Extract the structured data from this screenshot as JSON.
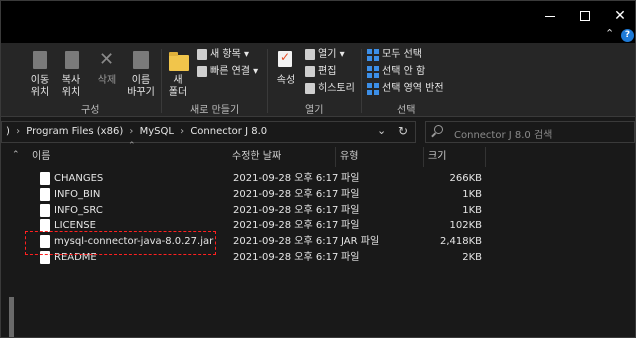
{
  "window_controls": {
    "minimize": "minimize",
    "maximize": "maximize",
    "close": "close"
  },
  "ribbon": {
    "buttons": {
      "move_to": "이동\n위치",
      "copy_to": "복사\n위치",
      "delete": "삭제",
      "rename": "이름\n바꾸기",
      "new_folder": "새\n폴더",
      "new_item": "새 항목",
      "easy_access": "빠른 연결",
      "properties": "속성",
      "open": "열기",
      "edit": "편집",
      "history": "히스토리",
      "select_all": "모두 선택",
      "select_none": "선택 안 함",
      "invert_selection": "선택 영역 반전"
    },
    "groups": {
      "organize": "구성",
      "new": "새로 만들기",
      "open": "열기",
      "select": "선택"
    }
  },
  "address": {
    "crumbs": [
      "Program Files (x86)",
      "MySQL",
      "Connector J 8.0"
    ],
    "leading_sep": ")"
  },
  "search": {
    "placeholder": "Connector J 8.0 검색"
  },
  "columns": {
    "name": "이름",
    "date": "수정한 날짜",
    "type": "유형",
    "size": "크기"
  },
  "files": [
    {
      "name": "CHANGES",
      "date": "2021-09-28 오후 6:17",
      "type": "파일",
      "size": "266KB"
    },
    {
      "name": "INFO_BIN",
      "date": "2021-09-28 오후 6:17",
      "type": "파일",
      "size": "1KB"
    },
    {
      "name": "INFO_SRC",
      "date": "2021-09-28 오후 6:17",
      "type": "파일",
      "size": "1KB"
    },
    {
      "name": "LICENSE",
      "date": "2021-09-28 오후 6:17",
      "type": "파일",
      "size": "102KB"
    },
    {
      "name": "mysql-connector-java-8.0.27.jar",
      "date": "2021-09-28 오후 6:17",
      "type": "JAR 파일",
      "size": "2,418KB"
    },
    {
      "name": "README",
      "date": "2021-09-28 오후 6:17",
      "type": "파일",
      "size": "2KB"
    }
  ],
  "highlight_color": "#ff2020",
  "accent_color": "#1e7ad6"
}
